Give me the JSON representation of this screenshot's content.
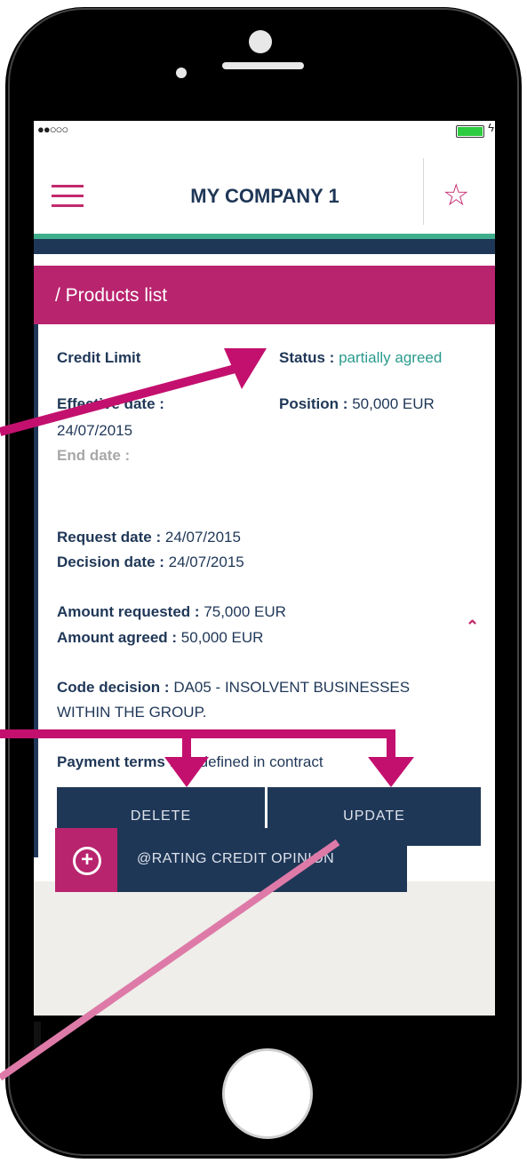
{
  "status_bar": {
    "signal": "●●○○○",
    "battery_icon": "battery-icon",
    "charging_icon": "bolt-icon"
  },
  "header": {
    "title": "MY COMPANY 1",
    "menu_icon": "hamburger-icon",
    "favorite_icon": "star-icon"
  },
  "section": {
    "breadcrumb": "/ Products list"
  },
  "product": {
    "name": "Credit Limit",
    "status_label": "Status :",
    "status_value": "partially agreed",
    "effective_label": "Effective date :",
    "effective_value": "24/07/2015",
    "position_label": "Position :",
    "position_value": "50,000 EUR",
    "end_label": "End date :",
    "request_label": "Request date :",
    "request_value": "24/07/2015",
    "decision_label": "Decision date :",
    "decision_value": "24/07/2015",
    "amount_requested_label": "Amount requested :",
    "amount_requested_value": "75,000 EUR",
    "amount_agreed_label": "Amount agreed :",
    "amount_agreed_value": "50,000 EUR",
    "code_label": "Code decision :",
    "code_value_line1": "DA05 - INSOLVENT BUSINESSES",
    "code_value_line2": "WITHIN THE GROUP.",
    "payment_label": "Payment terms :",
    "payment_value": "As defined in contract"
  },
  "actions": {
    "delete_label": "DELETE",
    "update_label": "UPDATE"
  },
  "footer": {
    "rating_label": "@RATING CREDIT OPINION"
  },
  "colors": {
    "accent": "#b8246e",
    "navy": "#1f3757",
    "teal": "#2a9b8c",
    "arrow": "#c3106e",
    "arrow_light": "#de7aa8"
  }
}
